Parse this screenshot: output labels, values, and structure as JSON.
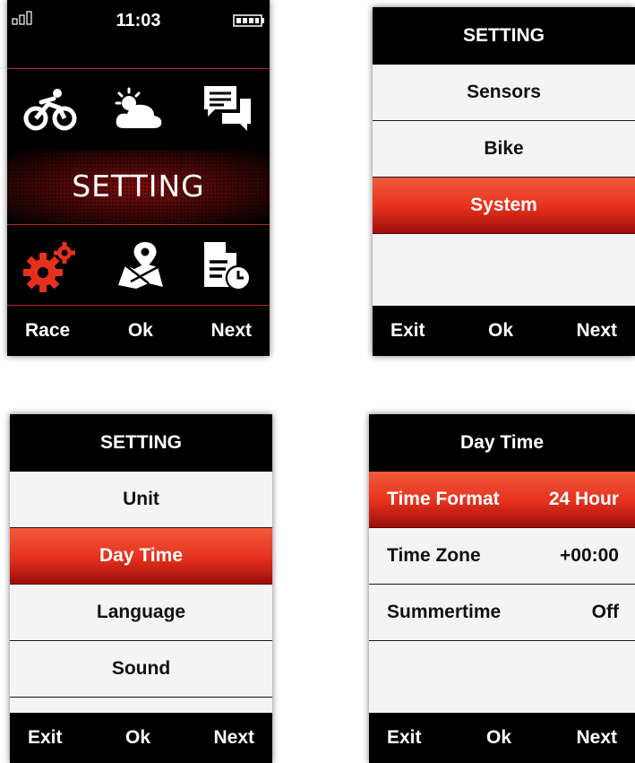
{
  "screen1": {
    "time": "11:03",
    "banner": "SETTING",
    "icons": [
      "bike-icon",
      "weather-icon",
      "messages-icon",
      "settings-gears-icon",
      "map-location-icon",
      "history-file-icon"
    ],
    "footer": {
      "left": "Race",
      "center": "Ok",
      "right": "Next"
    }
  },
  "screen2": {
    "title": "SETTING",
    "items": [
      "Sensors",
      "Bike",
      "System"
    ],
    "selected": "System",
    "footer": {
      "left": "Exit",
      "center": "Ok",
      "right": "Next"
    }
  },
  "screen3": {
    "title": "SETTING",
    "items": [
      "Unit",
      "Day Time",
      "Language",
      "Sound"
    ],
    "selected": "Day Time",
    "footer": {
      "left": "Exit",
      "center": "Ok",
      "right": "Next"
    }
  },
  "screen4": {
    "title": "Day Time",
    "rows": [
      {
        "label": "Time Format",
        "value": "24 Hour"
      },
      {
        "label": "Time Zone",
        "value": "+00:00"
      },
      {
        "label": "Summertime",
        "value": "Off"
      }
    ],
    "selected": "Time Format",
    "footer": {
      "left": "Exit",
      "center": "Ok",
      "right": "Next"
    }
  },
  "colors": {
    "accent": "#e5301d",
    "dark": "#000000",
    "list_bg": "#f4f4f4"
  }
}
